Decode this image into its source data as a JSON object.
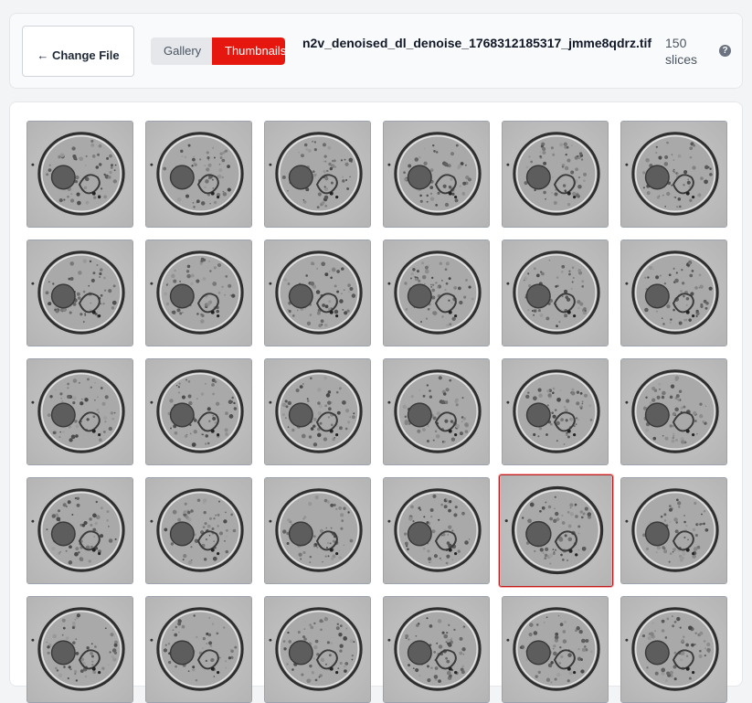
{
  "header": {
    "change_file_label": "← Change File",
    "view_toggle": {
      "options": [
        "Gallery",
        "Thumbnails"
      ],
      "selected": "Thumbnails"
    },
    "filename": "n2v_denoised_dl_denoise_1768312185317_jmme8qdrz.tif",
    "slice_count": "150 slices",
    "help_icon": "question-circle-icon"
  },
  "thumbnails": {
    "columns": 6,
    "visible_rows": 5,
    "selected_index": 22,
    "image_label": "cell-microscopy-slice"
  },
  "colors": {
    "accent": "#e5170f",
    "selected_border": "#b91c1c"
  }
}
